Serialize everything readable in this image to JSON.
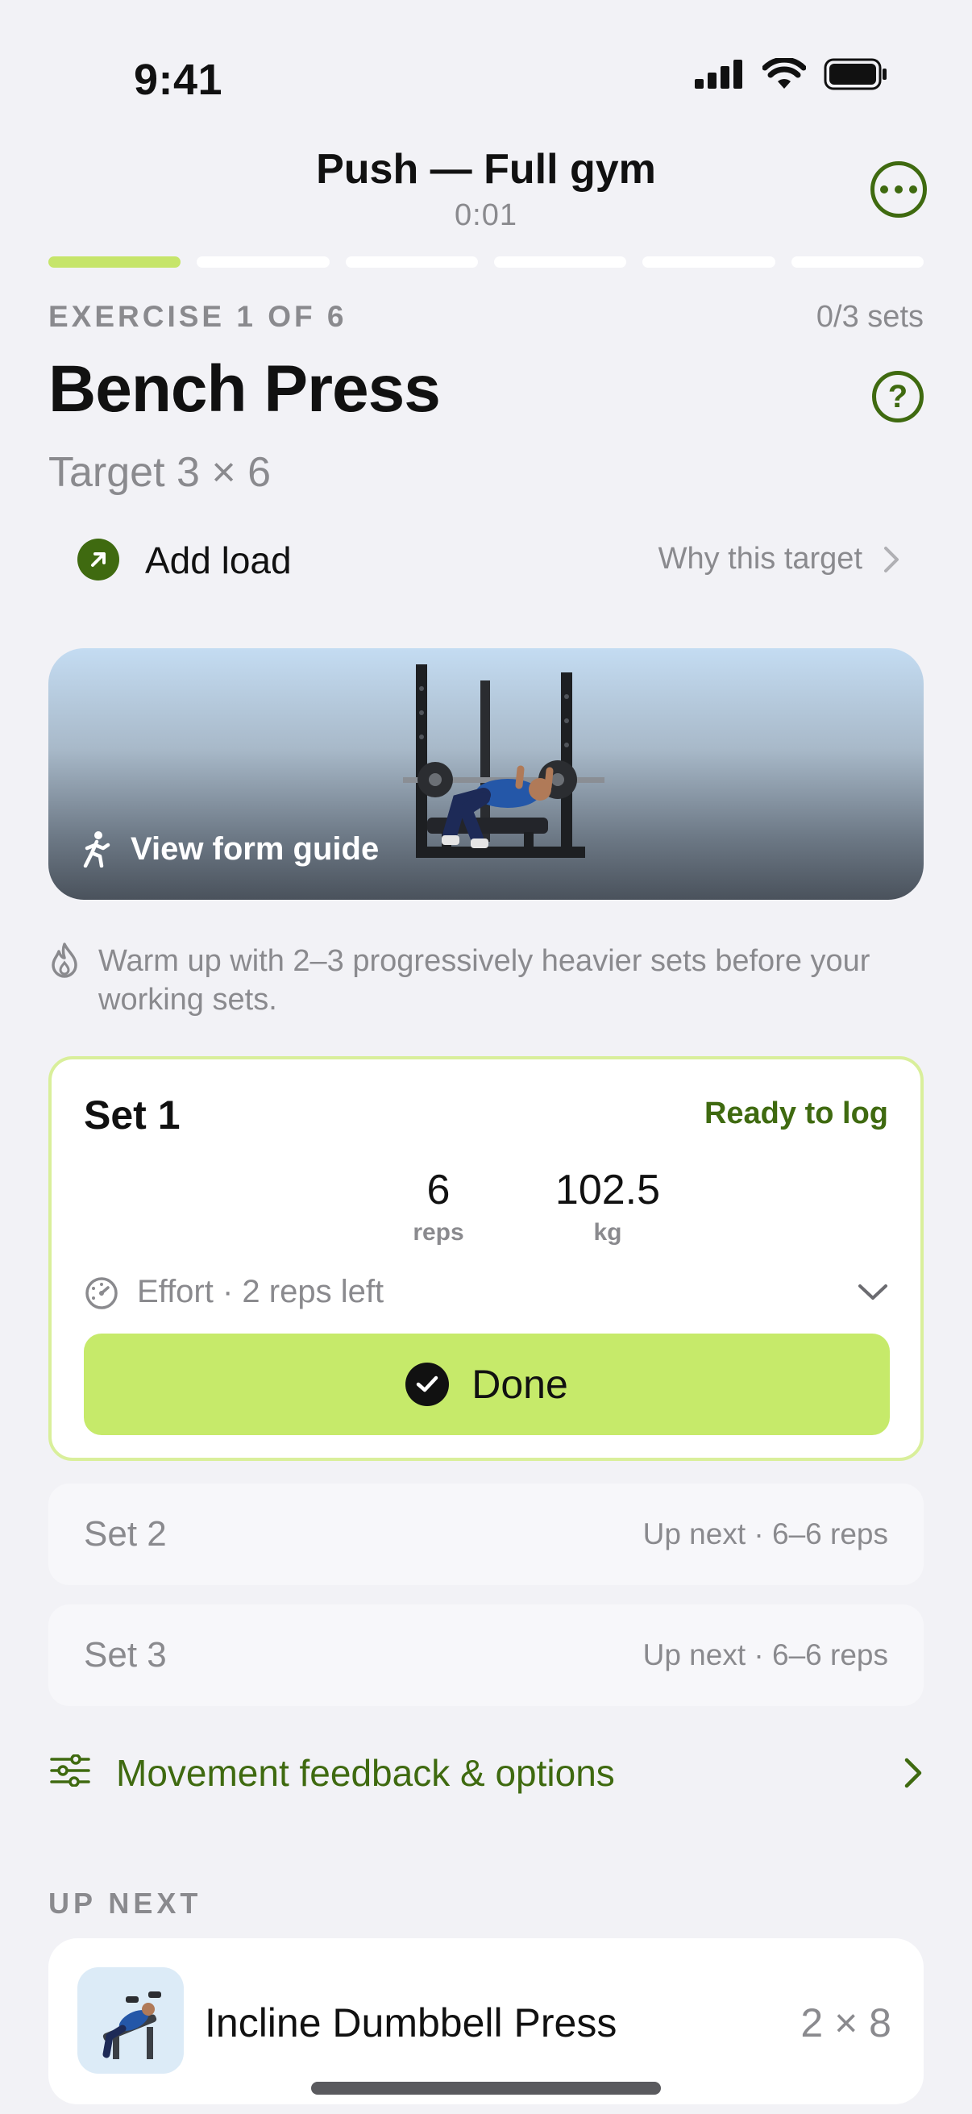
{
  "status_bar": {
    "time": "9:41"
  },
  "header": {
    "title": "Push — Full gym",
    "timer": "0:01"
  },
  "progress": {
    "segments": 6,
    "current": 1
  },
  "exercise": {
    "counter": "EXERCISE 1 OF 6",
    "sets_done": "0/3 sets",
    "name": "Bench Press",
    "target": "Target 3 × 6",
    "add_load": "Add load",
    "why_target": "Why this target",
    "form_guide": "View form guide"
  },
  "tip": {
    "text": "Warm up with 2–3 progressively heavier sets before your working sets."
  },
  "current_set": {
    "title": "Set 1",
    "status": "Ready to log",
    "reps": "6",
    "reps_label": "reps",
    "weight": "102.5",
    "weight_label": "kg",
    "effort": "Effort · 2 reps left",
    "done_label": "Done"
  },
  "upcoming_sets": [
    {
      "name": "Set 2",
      "meta": "Up next · 6–6 reps"
    },
    {
      "name": "Set 3",
      "meta": "Up next · 6–6 reps"
    }
  ],
  "movement_feedback": "Movement feedback & options",
  "up_next": {
    "label": "UP NEXT",
    "exercise": "Incline Dumbbell Press",
    "target": "2 × 8"
  },
  "colors": {
    "accent": "#3f6a10",
    "done_button": "#c6ea6a",
    "progress_active": "#c6e56a"
  }
}
